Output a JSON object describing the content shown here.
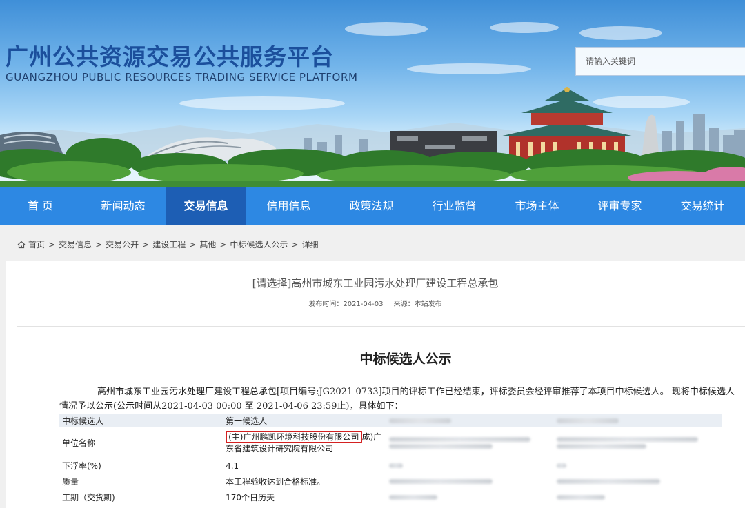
{
  "header": {
    "title_cn": "广州公共资源交易公共服务平台",
    "title_en": "GUANGZHOU PUBLIC RESOURCES TRADING SERVICE PLATFORM",
    "search_placeholder": "请输入关键词"
  },
  "nav": {
    "items": [
      {
        "label": "首 页"
      },
      {
        "label": "新闻动态"
      },
      {
        "label": "交易信息",
        "active": true
      },
      {
        "label": "信用信息"
      },
      {
        "label": "政策法规"
      },
      {
        "label": "行业监督"
      },
      {
        "label": "市场主体"
      },
      {
        "label": "评审专家"
      },
      {
        "label": "交易统计"
      }
    ]
  },
  "breadcrumb": [
    "首页",
    "交易信息",
    "交易公开",
    "建设工程",
    "其他",
    "中标候选人公示",
    "详细"
  ],
  "breadcrumb_sep": ">",
  "article": {
    "title": "[请选择]高州市城东工业园污水处理厂建设工程总承包",
    "publish_time": "发布时间：2021-04-03",
    "source": "来源：本站发布",
    "notice_title": "中标候选人公示",
    "paragraph": "高州市城东工业园污水处理厂建设工程总承包[项目编号:JG2021-0733]项目的评标工作已经结束，评标委员会经评审推荐了本项目中标候选人。 现将中标候选人情况予以公示(公示时间从2021-04-03 00:00 至 2021-04-06 23:59止)，具体如下："
  },
  "table": {
    "header": [
      "中标候选人",
      "第一候选人"
    ],
    "unit_label": "单位名称",
    "unit_prefix": "(主)",
    "unit_highlight": "广州鹏凯环境科技股份有限公司",
    "unit_suffix": "成)广东省建筑设计研究院有限公司",
    "rows": [
      {
        "label": "下浮率(%)",
        "value": "4.1"
      },
      {
        "label": "质量",
        "value": "本工程验收达到合格标准。"
      },
      {
        "label": "工期（交货期)",
        "value": "170个日历天"
      }
    ]
  },
  "colors": {
    "nav_bg": "#2d88e3",
    "nav_active": "#1d5eb4",
    "title_blue": "#1b4f9c",
    "highlight_red": "#d42121"
  }
}
